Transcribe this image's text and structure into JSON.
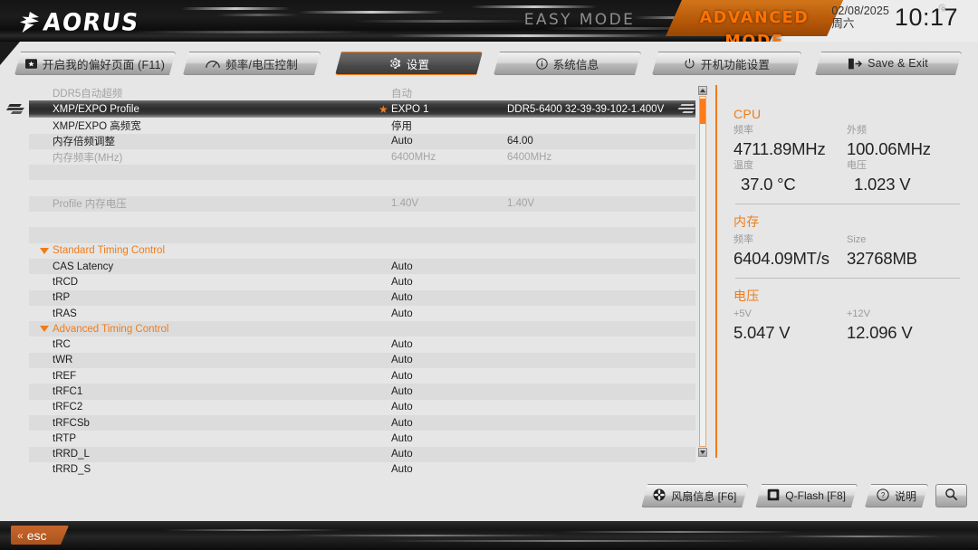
{
  "header": {
    "brand": "AORUS",
    "brand_icon": "aorus-falcon-logo",
    "mode_easy": "EASY MODE",
    "mode_advanced": "ADVANCED MODE",
    "date": "02/08/2025",
    "weekday": "周六",
    "time": "10:17",
    "settings_icon": "gear-icon"
  },
  "nav": {
    "tabs": [
      {
        "label": "开启我的偏好页面 (F11)",
        "icon": "favorites-icon",
        "active": false
      },
      {
        "label": "频率/电压控制",
        "icon": "tweaker-gauge-icon",
        "active": false
      },
      {
        "label": "设置",
        "icon": "gear-icon",
        "active": true
      },
      {
        "label": "系统信息",
        "icon": "info-circle-icon",
        "active": false
      },
      {
        "label": "开机功能设置",
        "icon": "power-icon",
        "active": false
      },
      {
        "label": "Save & Exit",
        "icon": "exit-door-icon",
        "active": false
      }
    ]
  },
  "list": {
    "rows": [
      {
        "label": "DDR5自动超频",
        "value1": "自动",
        "value2": "",
        "style": "dim",
        "type": "item"
      },
      {
        "label": "XMP/EXPO Profile",
        "value1": "EXPO 1",
        "value2": "DDR5-6400 32-39-39-102-1.400V",
        "style": "selected",
        "type": "item",
        "star": true
      },
      {
        "label": "XMP/EXPO 高频宽",
        "value1": "停用",
        "value2": "",
        "style": "normal",
        "type": "item"
      },
      {
        "label": "内存倍频调整",
        "value1": "Auto",
        "value2": "64.00",
        "style": "normal",
        "type": "item"
      },
      {
        "label": "内存频率(MHz)",
        "value1": "6400MHz",
        "value2": "6400MHz",
        "style": "dim",
        "type": "item"
      },
      {
        "label": "",
        "value1": "",
        "value2": "",
        "style": "normal",
        "type": "spacer"
      },
      {
        "label": "",
        "value1": "",
        "value2": "",
        "style": "normal",
        "type": "spacer"
      },
      {
        "label": "Profile 内存电压",
        "value1": "1.40V",
        "value2": "1.40V",
        "style": "dim",
        "type": "item"
      },
      {
        "label": "",
        "value1": "",
        "value2": "",
        "style": "normal",
        "type": "spacer"
      },
      {
        "label": "",
        "value1": "",
        "value2": "",
        "style": "normal",
        "type": "spacer"
      },
      {
        "label": "Standard Timing Control",
        "value1": "",
        "value2": "",
        "style": "normal",
        "type": "section"
      },
      {
        "label": "CAS Latency",
        "value1": "Auto",
        "value2": "",
        "style": "normal",
        "type": "item"
      },
      {
        "label": "tRCD",
        "value1": "Auto",
        "value2": "",
        "style": "normal",
        "type": "item"
      },
      {
        "label": "tRP",
        "value1": "Auto",
        "value2": "",
        "style": "normal",
        "type": "item"
      },
      {
        "label": "tRAS",
        "value1": "Auto",
        "value2": "",
        "style": "normal",
        "type": "item"
      },
      {
        "label": "Advanced Timing Control",
        "value1": "",
        "value2": "",
        "style": "normal",
        "type": "section"
      },
      {
        "label": "tRC",
        "value1": "Auto",
        "value2": "",
        "style": "normal",
        "type": "item"
      },
      {
        "label": "tWR",
        "value1": "Auto",
        "value2": "",
        "style": "normal",
        "type": "item"
      },
      {
        "label": "tREF",
        "value1": "Auto",
        "value2": "",
        "style": "normal",
        "type": "item"
      },
      {
        "label": "tRFC1",
        "value1": "Auto",
        "value2": "",
        "style": "normal",
        "type": "item"
      },
      {
        "label": "tRFC2",
        "value1": "Auto",
        "value2": "",
        "style": "normal",
        "type": "item"
      },
      {
        "label": "tRFCSb",
        "value1": "Auto",
        "value2": "",
        "style": "normal",
        "type": "item"
      },
      {
        "label": "tRTP",
        "value1": "Auto",
        "value2": "",
        "style": "normal",
        "type": "item"
      },
      {
        "label": "tRRD_L",
        "value1": "Auto",
        "value2": "",
        "style": "normal",
        "type": "item"
      },
      {
        "label": "tRRD_S",
        "value1": "Auto",
        "value2": "",
        "style": "normal",
        "type": "item"
      }
    ]
  },
  "hardware": {
    "groups": [
      {
        "title": "CPU",
        "cells": [
          {
            "caption": "频率",
            "value": "4711.89MHz"
          },
          {
            "caption": "外频",
            "value": "100.06MHz"
          },
          {
            "caption": "温度",
            "value": "37.0 °C"
          },
          {
            "caption": "电压",
            "value": "1.023 V"
          }
        ]
      },
      {
        "title": "内存",
        "cells": [
          {
            "caption": "频率",
            "value": "6404.09MT/s"
          },
          {
            "caption": "Size",
            "value": "32768MB"
          }
        ]
      },
      {
        "title": "电压",
        "cells": [
          {
            "caption": "+5V",
            "value": "5.047 V"
          },
          {
            "caption": "+12V",
            "value": "12.096 V"
          }
        ]
      }
    ]
  },
  "bottom": {
    "buttons": [
      {
        "label": "风扇信息 [F6]",
        "icon": "fan-icon"
      },
      {
        "label": "Q-Flash [F8]",
        "icon": "qflash-chip-icon"
      },
      {
        "label": "说明",
        "icon": "question-circle-icon"
      }
    ],
    "search_icon": "search-icon"
  },
  "footer": {
    "esc_label": "esc",
    "esc_icon": "double-chevron-left-icon"
  },
  "colors": {
    "accent": "#ef7c1a",
    "accent_bright": "#ff7a18",
    "panel_bg": "#e6e6e6",
    "row_alt": "#dcdcdc",
    "text": "#1c1c1c",
    "text_dim": "#a3a3a3"
  }
}
